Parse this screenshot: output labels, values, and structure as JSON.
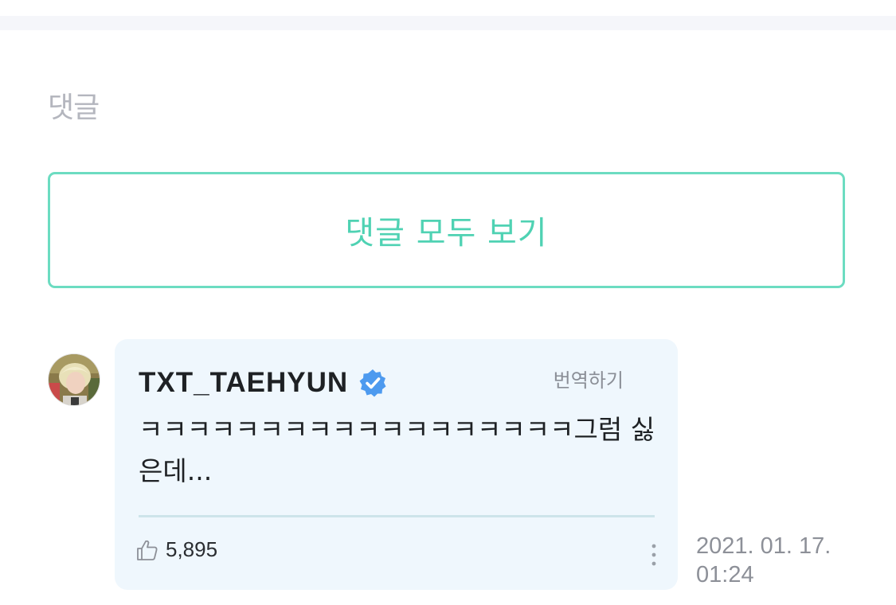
{
  "section": {
    "title": "댓글"
  },
  "view_all_button": {
    "label": "댓글 모두 보기"
  },
  "comment": {
    "author": "TXT_TAEHYUN",
    "verified": true,
    "translate_label": "번역하기",
    "body": "ㅋㅋㅋㅋㅋㅋㅋㅋㅋㅋㅋㅋㅋㅋㅋㅋㅋㅋ그럼 싫은데...",
    "likes": "5,895",
    "date": "2021. 01. 17.",
    "time": "01:24"
  },
  "icons": {
    "verified": "verified-badge-icon",
    "like": "thumbs-up-icon",
    "more": "more-vertical-icon"
  },
  "colors": {
    "accent": "#4fd2b3",
    "verified": "#4d9aef",
    "card_background": "#eff7fd"
  }
}
